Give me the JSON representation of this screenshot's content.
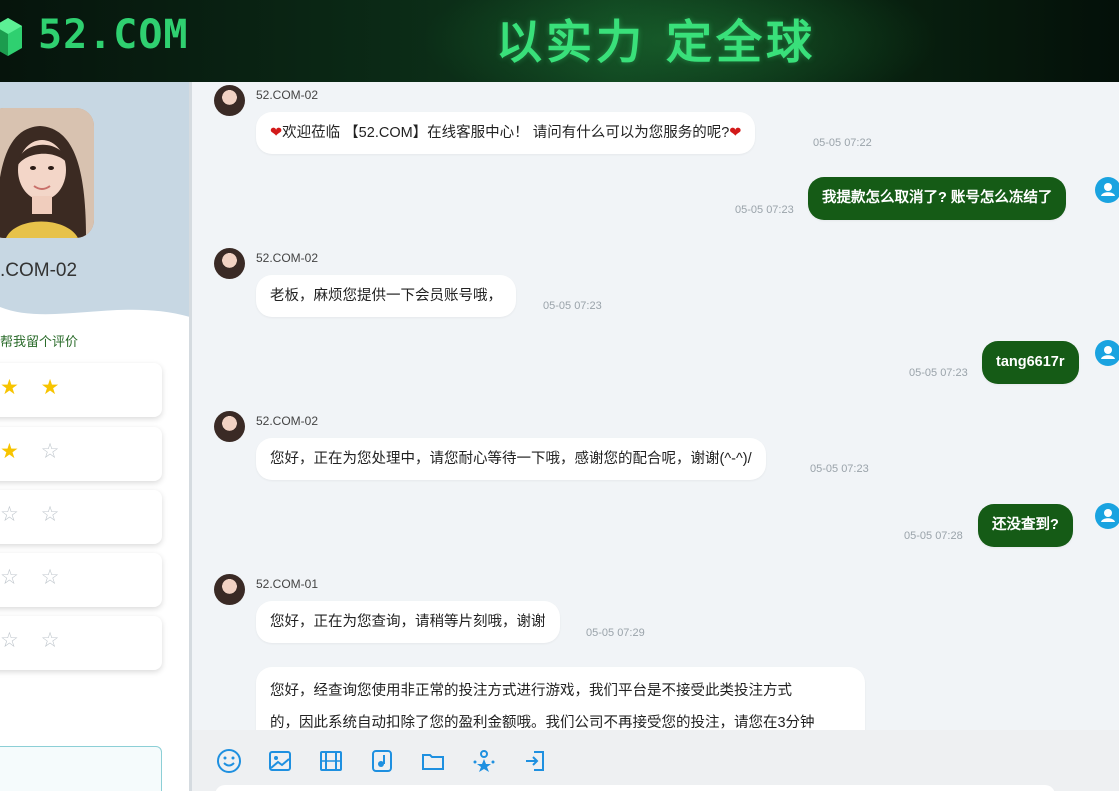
{
  "header": {
    "logo_text": "52.COM",
    "slogan": "以实力 定全球"
  },
  "sidebar": {
    "agent_name": ".COM-02",
    "rate_prompt": "帮我留个评价",
    "ratings": [
      {
        "filled": "★ ★",
        "empty": ""
      },
      {
        "filled": "★",
        "empty": "☆"
      },
      {
        "filled": "",
        "empty": "☆ ☆"
      },
      {
        "filled": "",
        "empty": "☆ ☆"
      },
      {
        "filled": "",
        "empty": "☆ ☆"
      }
    ]
  },
  "messages": [
    {
      "sender": "52.COM-02",
      "text": "欢迎莅临 【52.COM】在线客服中心！ 请问有什么可以为您服务的呢?",
      "time": "05-05 07:22"
    },
    {
      "text": "我提款怎么取消了? 账号怎么冻结了",
      "time": "05-05 07:23"
    },
    {
      "sender": "52.COM-02",
      "text": "老板，麻烦您提供一下会员账号哦，",
      "time": "05-05 07:23"
    },
    {
      "text": "tang6617r",
      "time": "05-05 07:23"
    },
    {
      "sender": "52.COM-02",
      "text": "您好，正在为您处理中，请您耐心等待一下哦，感谢您的配合呢，谢谢(^-^)/",
      "time": "05-05 07:23"
    },
    {
      "text": "还没查到?",
      "time": "05-05 07:28"
    },
    {
      "sender": "52.COM-01",
      "text": "您好，正在为您查询，请稍等片刻哦，谢谢",
      "time": "05-05 07:29"
    },
    {
      "text_line1": "您好，经查询您使用非正常的投注方式进行游戏，我们平台是不接受此类投注方式",
      "text_line2": "的，因此系统自动扣除了您的盈利金额哦。我们公司不再接受您的投注，请您在3分钟"
    }
  ],
  "toolbar": {
    "icons": [
      "emoji-icon",
      "image-icon",
      "video-icon",
      "music-file-icon",
      "folder-icon",
      "rating-icon",
      "exit-icon"
    ]
  },
  "colors": {
    "accent_green": "#155b16",
    "brand_green": "#2fd070",
    "user_icon_blue": "#1aa3e0",
    "star_gold": "#f7c400"
  }
}
